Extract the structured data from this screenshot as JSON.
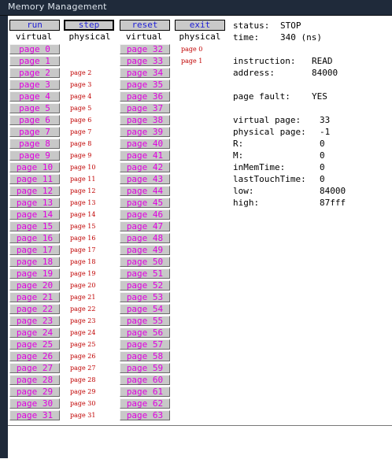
{
  "window": {
    "title": "Memory Management"
  },
  "controls": [
    {
      "label": "run"
    },
    {
      "label": "step"
    },
    {
      "label": "reset"
    },
    {
      "label": "exit"
    }
  ],
  "columns": {
    "virtual_left": "virtual",
    "physical_left": "physical",
    "virtual_right": "virtual",
    "physical_right": "physical"
  },
  "left_virtual": [
    "page 0",
    "page 1",
    "page 2",
    "page 3",
    "page 4",
    "page 5",
    "page 6",
    "page 7",
    "page 8",
    "page 9",
    "page 10",
    "page 11",
    "page 12",
    "page 13",
    "page 14",
    "page 15",
    "page 16",
    "page 17",
    "page 18",
    "page 19",
    "page 20",
    "page 21",
    "page 22",
    "page 23",
    "page 24",
    "page 25",
    "page 26",
    "page 27",
    "page 28",
    "page 29",
    "page 30",
    "page 31"
  ],
  "left_physical": [
    "",
    "",
    "page 2",
    "page 3",
    "page 4",
    "page 5",
    "page 6",
    "page 7",
    "page 8",
    "page 9",
    "page 10",
    "page 11",
    "page 12",
    "page 13",
    "page 14",
    "page 15",
    "page 16",
    "page 17",
    "page 18",
    "page 19",
    "page 20",
    "page 21",
    "page 22",
    "page 23",
    "page 24",
    "page 25",
    "page 26",
    "page 27",
    "page 28",
    "page 29",
    "page 30",
    "page 31"
  ],
  "right_virtual": [
    "page 32",
    "page 33",
    "page 34",
    "page 35",
    "page 36",
    "page 37",
    "page 38",
    "page 39",
    "page 40",
    "page 41",
    "page 42",
    "page 43",
    "page 44",
    "page 45",
    "page 46",
    "page 47",
    "page 48",
    "page 49",
    "page 50",
    "page 51",
    "page 52",
    "page 53",
    "page 54",
    "page 55",
    "page 56",
    "page 57",
    "page 58",
    "page 59",
    "page 60",
    "page 61",
    "page 62",
    "page 63"
  ],
  "right_physical": [
    "page 0",
    "page 1"
  ],
  "status": {
    "status_label": "status:",
    "status_value": "STOP",
    "time_label": "time:",
    "time_value": "340 (ns)",
    "instruction_label": "instruction:",
    "instruction_value": "READ",
    "address_label": "address:",
    "address_value": "84000",
    "page_fault_label": "page fault:",
    "page_fault_value": "YES",
    "virtual_page_label": "virtual page:",
    "virtual_page_value": "33",
    "physical_page_label": "physical page:",
    "physical_page_value": "-1",
    "r_label": "R:",
    "r_value": "0",
    "m_label": "M:",
    "m_value": "0",
    "inmemtime_label": "inMemTime:",
    "inmemtime_value": "0",
    "lasttouchtime_label": "lastTouchTime:",
    "lasttouchtime_value": "0",
    "low_label": "low:",
    "low_value": "84000",
    "high_label": "high:",
    "high_value": "87fff"
  },
  "colors": {
    "page_label": "#e000e0",
    "physical_label": "#c00000",
    "control_label": "#1f1fd6",
    "titlebar": "#1f2a3a"
  }
}
